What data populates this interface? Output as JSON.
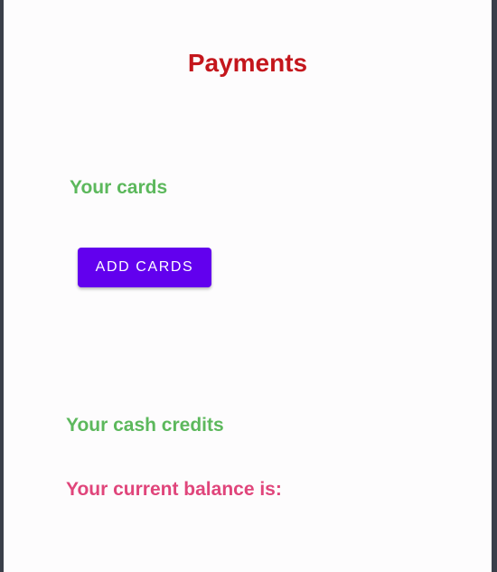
{
  "page": {
    "title": "Payments"
  },
  "cards": {
    "heading": "Your cards",
    "add_button_label": "ADD CARDS"
  },
  "credits": {
    "heading": "Your cash credits",
    "balance_label": "Your current balance is:"
  },
  "colors": {
    "title": "#c4161c",
    "section_heading": "#5cb85c",
    "balance_text": "#e0457b",
    "button": "#6200ee"
  }
}
